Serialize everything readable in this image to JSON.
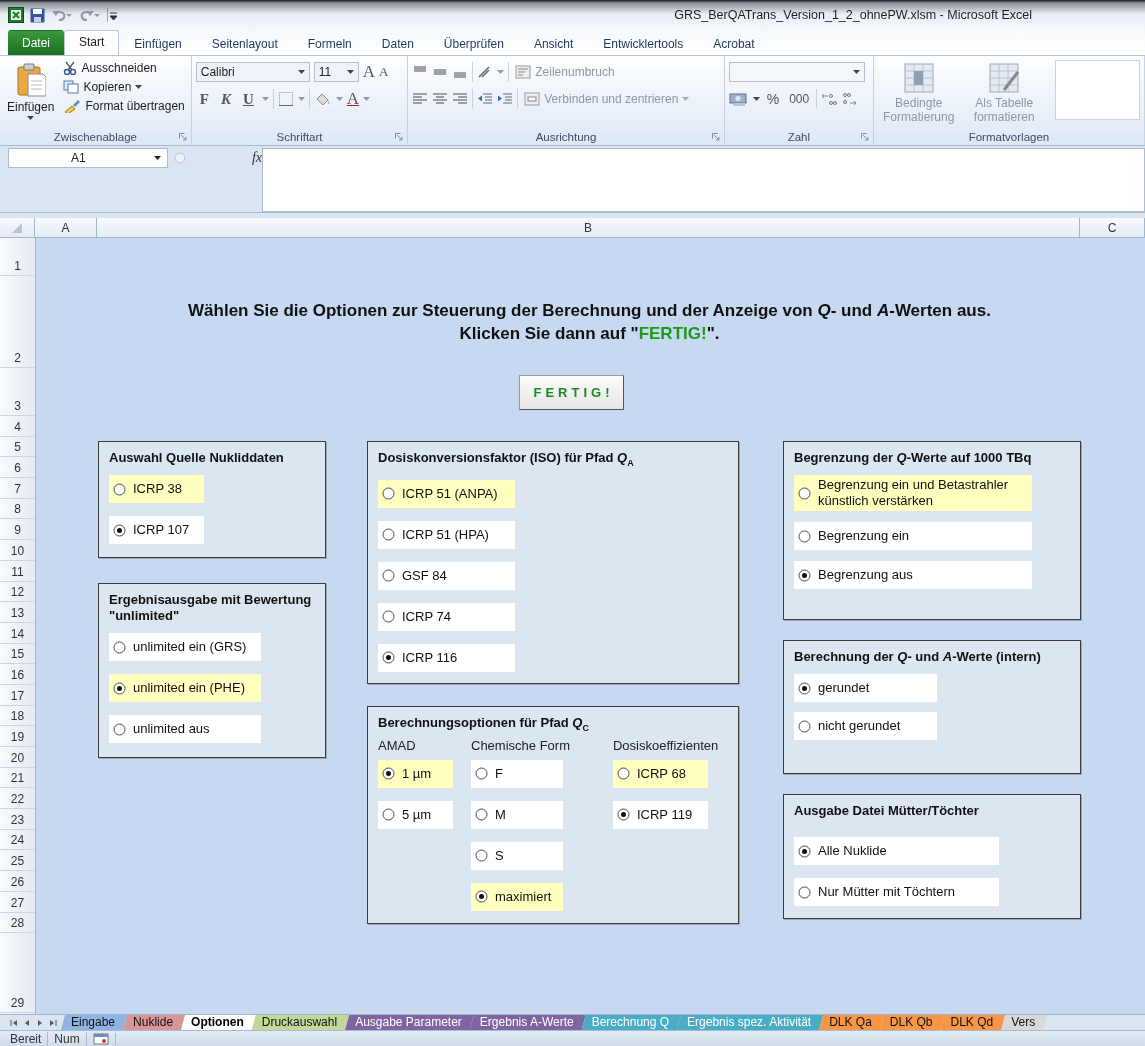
{
  "window": {
    "title": "GRS_BerQATrans_Version_1_2_ohnePW.xlsm  -  Microsoft Excel"
  },
  "ribbon_tabs": [
    {
      "label": "Datei",
      "kind": "file",
      "selected": false
    },
    {
      "label": "Start",
      "kind": "tab",
      "selected": true
    },
    {
      "label": "Einfügen",
      "kind": "tab",
      "selected": false
    },
    {
      "label": "Seitenlayout",
      "kind": "tab",
      "selected": false
    },
    {
      "label": "Formeln",
      "kind": "tab",
      "selected": false
    },
    {
      "label": "Daten",
      "kind": "tab",
      "selected": false
    },
    {
      "label": "Überprüfen",
      "kind": "tab",
      "selected": false
    },
    {
      "label": "Ansicht",
      "kind": "tab",
      "selected": false
    },
    {
      "label": "Entwicklertools",
      "kind": "tab",
      "selected": false
    },
    {
      "label": "Acrobat",
      "kind": "tab",
      "selected": false
    }
  ],
  "ribbon_groups": [
    {
      "kind": "clipboard",
      "label": "Zwischenablage",
      "paste": "Einfügen",
      "items": [
        "Ausschneiden",
        "Kopieren",
        "Format übertragen"
      ]
    },
    {
      "kind": "font",
      "label": "Schriftart",
      "font": "Calibri",
      "size": "11",
      "grow": "A",
      "shrink": "A",
      "styles": [
        "F",
        "K",
        "U"
      ],
      "font_color": "A"
    },
    {
      "kind": "alignment",
      "label": "Ausrichtung",
      "wrap": "Zeilenumbruch",
      "merge": "Verbinden und zentrieren",
      "disabled": true
    },
    {
      "kind": "number",
      "label": "Zahl",
      "percent": "%",
      "thousands": "000"
    },
    {
      "kind": "styles",
      "label": "Formatvorlagen",
      "items": [
        "Bedingte\nFormatierung",
        "Als Tabelle\nformatieren"
      ],
      "disabled": true
    }
  ],
  "formula_bar": {
    "name_box": "A1",
    "function_label": "fx"
  },
  "column_headers": [
    "A",
    "B",
    "C"
  ],
  "row_headers": [
    "1",
    "2",
    "3",
    "4",
    "5",
    "6",
    "7",
    "8",
    "9",
    "10",
    "11",
    "12",
    "13",
    "14",
    "15",
    "16",
    "17",
    "18",
    "19",
    "20",
    "21",
    "22",
    "23",
    "24",
    "25",
    "26",
    "27",
    "28",
    "29"
  ],
  "sheet": {
    "heading_line_1": "Wählen Sie die Optionen zur Steuerung der Berechnung und der Anzeige von *Q*- und *A*-Werten aus.",
    "heading_line_2": {
      "before": "Klicken Sie dann auf \"",
      "emphasis": "FERTIG!",
      "after": "\"."
    },
    "done_button": "FERTIG!",
    "panel_columns": [
      {
        "panels": [
          {
            "title": "Auswahl Quelle Nukliddaten",
            "kind": "list",
            "options": [
              {
                "label": "ICRP 38",
                "selected": false,
                "highlighted": true
              },
              {
                "label": "ICRP 107",
                "selected": true,
                "highlighted": false
              }
            ]
          },
          {
            "title": "Ergebnisausgabe mit Bewertung \"unlimited\"",
            "kind": "list",
            "options": [
              {
                "label": "unlimited ein (GRS)",
                "selected": false,
                "highlighted": false
              },
              {
                "label": "unlimited ein (PHE)",
                "selected": true,
                "highlighted": true
              },
              {
                "label": "unlimited aus",
                "selected": false,
                "highlighted": false
              }
            ]
          }
        ]
      },
      {
        "panels": [
          {
            "title": "Dosiskonversionsfaktor (ISO) für Pfad *Q*$_{A}$",
            "kind": "list",
            "options": [
              {
                "label": "ICRP 51 (ANPA)",
                "selected": false,
                "highlighted": true
              },
              {
                "label": "ICRP 51 (HPA)",
                "selected": false,
                "highlighted": false
              },
              {
                "label": "GSF 84",
                "selected": false,
                "highlighted": false
              },
              {
                "label": "ICRP 74",
                "selected": false,
                "highlighted": false
              },
              {
                "label": "ICRP 116",
                "selected": true,
                "highlighted": false
              }
            ]
          },
          {
            "title": "Berechnungsoptionen für Pfad *Q*$_{C}$",
            "kind": "columns",
            "columns": [
              {
                "heading": "AMAD",
                "options": [
                  {
                    "label": "1 µm",
                    "selected": true,
                    "highlighted": true
                  },
                  {
                    "label": "5 µm",
                    "selected": false,
                    "highlighted": false
                  }
                ]
              },
              {
                "heading": "Chemische Form",
                "options": [
                  {
                    "label": "F",
                    "selected": false,
                    "highlighted": false
                  },
                  {
                    "label": "M",
                    "selected": false,
                    "highlighted": false
                  },
                  {
                    "label": "S",
                    "selected": false,
                    "highlighted": false
                  },
                  {
                    "label": "maximiert",
                    "selected": true,
                    "highlighted": true
                  }
                ]
              },
              {
                "heading": "Dosiskoeffizienten",
                "options": [
                  {
                    "label": "ICRP 68",
                    "selected": false,
                    "highlighted": true
                  },
                  {
                    "label": "ICRP 119",
                    "selected": true,
                    "highlighted": false
                  }
                ]
              }
            ]
          }
        ]
      },
      {
        "panels": [
          {
            "title": "Begrenzung der *Q*-Werte auf 1000 TBq",
            "kind": "list",
            "options": [
              {
                "label": "Begrenzung ein und Betastrahler künstlich verstärken",
                "selected": false,
                "highlighted": true
              },
              {
                "label": "Begrenzung ein",
                "selected": false,
                "highlighted": false
              },
              {
                "label": "Begrenzung aus",
                "selected": true,
                "highlighted": false
              }
            ]
          },
          {
            "title": "Berechnung der *Q*- und *A*-Werte (intern)",
            "kind": "list",
            "options": [
              {
                "label": "gerundet",
                "selected": true,
                "highlighted": false
              },
              {
                "label": "nicht gerundet",
                "selected": false,
                "highlighted": false
              }
            ]
          },
          {
            "title": "Ausgabe Datei Mütter/Töchter",
            "kind": "list",
            "options": [
              {
                "label": "Alle Nuklide",
                "selected": true,
                "highlighted": false
              },
              {
                "label": "Nur Mütter mit Töchtern",
                "selected": false,
                "highlighted": false
              }
            ]
          }
        ]
      }
    ]
  },
  "sheet_tabs": [
    {
      "label": "Eingabe",
      "color": "#8db4e2",
      "selected": false
    },
    {
      "label": "Nuklide",
      "color": "#da9694",
      "selected": false
    },
    {
      "label": "Optionen",
      "color": "#ffffff",
      "selected": true
    },
    {
      "label": "Druckauswahl",
      "color": "#c4d79b",
      "selected": false
    },
    {
      "label": "Ausgabe Parameter",
      "color": "#8064a2",
      "selected": false
    },
    {
      "label": "Ergebnis A-Werte",
      "color": "#8064a2",
      "selected": false
    },
    {
      "label": "Berechnung Q",
      "color": "#4bacc6",
      "selected": false
    },
    {
      "label": "Ergebnis spez. Aktivität",
      "color": "#4bacc6",
      "selected": false
    },
    {
      "label": "DLK Qa",
      "color": "#f79646",
      "selected": false
    },
    {
      "label": "DLK Qb",
      "color": "#f79646",
      "selected": false
    },
    {
      "label": "DLK Qd",
      "color": "#f79646",
      "selected": false
    },
    {
      "label": "Vers",
      "color": "#d9d9d9",
      "selected": false
    }
  ],
  "status_bar": {
    "mode": "Bereit",
    "num_lock": "Num"
  }
}
